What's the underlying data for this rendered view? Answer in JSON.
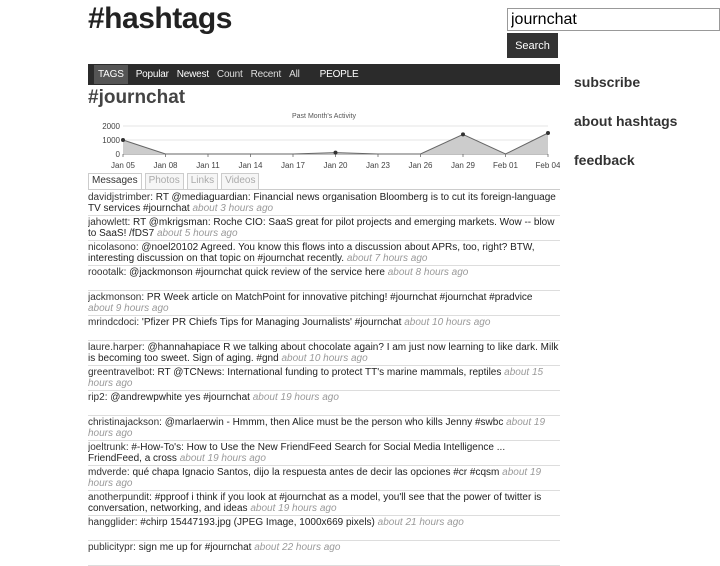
{
  "site": {
    "logo": "#hashtags"
  },
  "search": {
    "value": "journchat",
    "button": "Search"
  },
  "nav": {
    "items": [
      "TAGS",
      "Popular",
      "Newest",
      "Count",
      "Recent",
      "All",
      "PEOPLE"
    ]
  },
  "page": {
    "title": "#journchat"
  },
  "chart_data": {
    "type": "line",
    "title": "Past Month's Activity",
    "categories": [
      "Jan 05",
      "Jan 08",
      "Jan 11",
      "Jan 14",
      "Jan 17",
      "Jan 20",
      "Jan 23",
      "Jan 26",
      "Jan 29",
      "Feb 01",
      "Feb 04"
    ],
    "y_ticks": [
      "2000",
      "1000",
      "0"
    ],
    "ylim": [
      0,
      2000
    ],
    "x": [
      0,
      1,
      2,
      3,
      4,
      5,
      6,
      7,
      8,
      9,
      10
    ],
    "values": [
      1000,
      0,
      0,
      0,
      0,
      100,
      0,
      0,
      1400,
      0,
      1500
    ],
    "grid": true
  },
  "tabs": [
    "Messages",
    "Photos",
    "Links",
    "Videos"
  ],
  "messages": [
    {
      "user": "davidjstrimber",
      "text": ": RT @mediaguardian: Financial news organisation Bloomberg is to cut its foreign-language TV services #journchat",
      "time": "about 3 hours ago"
    },
    {
      "user": "jahowlett",
      "text": ": RT @mkrigsman: Roche CIO: SaaS great for pilot projects and emerging markets. Wow -- blow to SaaS! /fDS7",
      "time": "about 5 hours ago"
    },
    {
      "user": "nicolasono",
      "text": ": @noel20102 Agreed. You know this flows into a discussion about APRs, too, right? BTW, interesting discussion on that topic on #journchat recently.",
      "time": "about 7 hours ago"
    },
    {
      "user": "roootalk",
      "text": ": @jackmonson #journchat quick review of the service here",
      "time": "about 8 hours ago"
    },
    {
      "user": "jackmonson",
      "text": ": PR Week article on MatchPoint for innovative pitching! #journchat #journchat #pradvice",
      "time": "about 9 hours ago"
    },
    {
      "user": "mrindcdoci",
      "text": ": 'Pfizer PR Chiefs Tips for Managing Journalists' #journchat",
      "time": "about 10 hours ago"
    },
    {
      "user": "laure.harper",
      "text": ": @hannahapiace R we talking about chocolate again? I am just now learning to like dark. Milk is becoming too sweet. Sign of aging. #gnd",
      "time": "about 10 hours ago"
    },
    {
      "user": "greentravelbot",
      "text": ": RT @TCNews: International funding to protect TT's marine mammals, reptiles",
      "time": "about 15 hours ago"
    },
    {
      "user": "rip2",
      "text": ": @andrewpwhite yes #journchat",
      "time": "about 19 hours ago"
    },
    {
      "user": "christinajackson",
      "text": ": @marlaerwin - Hmmm, then Alice must be the person who kills Jenny #swbc",
      "time": "about 19 hours ago"
    },
    {
      "user": "joeltrunk",
      "text": ": #-How-To's: How to Use the New FriendFeed Search for Social Media Intelligence ... FriendFeed, a cross",
      "time": "about 19 hours ago"
    },
    {
      "user": "mdverde",
      "text": ": qué chapa Ignacio Santos, dijo la respuesta antes de decir las opciones #cr #cqsm",
      "time": "about 19 hours ago"
    },
    {
      "user": "anotherpundit",
      "text": ": #pproof i think if you look at #journchat as a model, you'll see that the power of twitter is conversation, networking, and ideas",
      "time": "about 19 hours ago"
    },
    {
      "user": "hangglider",
      "text": ": #chirp 15447193.jpg (JPEG Image, 1000x669 pixels)",
      "time": "about 21 hours ago"
    },
    {
      "user": "publicitypr",
      "text": ": sign me up for #journchat",
      "time": "about 22 hours ago"
    }
  ],
  "sidebar": {
    "subscribe": "subscribe",
    "about": "about hashtags",
    "feedback": "feedback"
  }
}
